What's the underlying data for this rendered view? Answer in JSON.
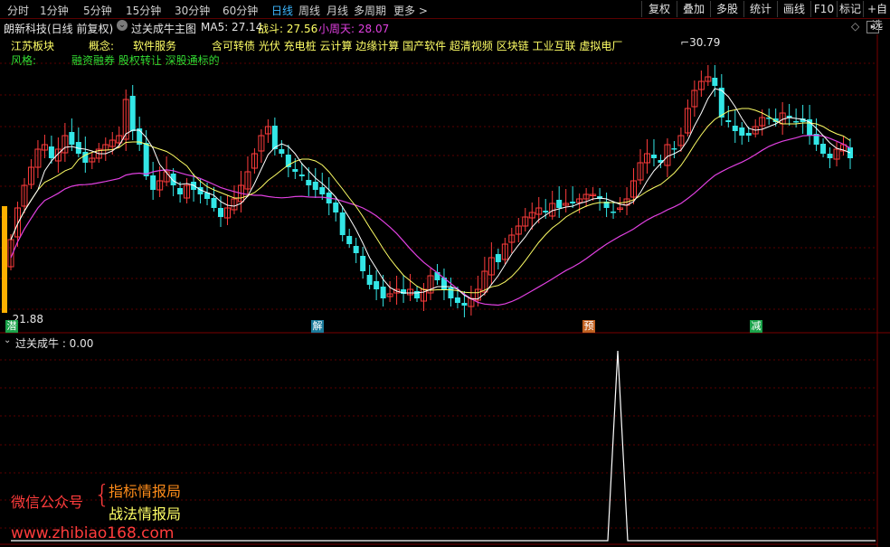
{
  "toolbar": {
    "timeframes": [
      "分时",
      "1分钟",
      "5分钟",
      "15分钟",
      "30分钟",
      "60分钟",
      "日线",
      "周线",
      "月线",
      "多周期",
      "更多 >"
    ],
    "active": "日线",
    "buttons": [
      "复权",
      "叠加",
      "多股",
      "统计",
      "画线",
      "F10",
      "标记",
      "+自选"
    ]
  },
  "info": {
    "stock": "朗新科技(日线 前复权)",
    "indicator_name": "过关成牛主图",
    "ma5_label": "MA5: 27.14",
    "zhandou_label": "战斗: 27.56",
    "xiaozhoutian_label": "小周天: 28.07"
  },
  "blocks": {
    "region": "江苏板块",
    "concept_label": "概念:",
    "concept_value": "软件服务",
    "concept_tags": "含可转债 光伏 充电桩 云计算 边缘计算 国产软件 超清视频 区块链 工业互联 虚拟电厂",
    "style_label": "风格:",
    "style_tags": "融资融券 股权转让 深股通标的"
  },
  "chart": {
    "high_label": "30.79",
    "low_label": "21.88",
    "markers": [
      "潜",
      "解",
      "预",
      "减"
    ]
  },
  "sub_panel": {
    "title": "过关成牛 : 0.00"
  },
  "promo": {
    "wechat": "微信公众号",
    "line1": "指标情报局",
    "line2": "战法情报局",
    "url": "www.zhibiao168.com"
  },
  "colors": {
    "up": "#ff3c3c",
    "down": "#33e6e6",
    "ma5": "#ffffff",
    "zhandou": "#ffff66",
    "xiaozhoutian": "#e040e0",
    "grid": "#5a0000"
  },
  "chart_data": {
    "type": "candlestick",
    "price_range": [
      21.88,
      30.79
    ],
    "series": [
      {
        "name": "MA5",
        "value": 27.14
      },
      {
        "name": "战斗",
        "value": 27.56
      },
      {
        "name": "小周天",
        "value": 28.07
      }
    ],
    "sub_indicator": {
      "name": "过关成牛",
      "value": 0.0
    }
  }
}
